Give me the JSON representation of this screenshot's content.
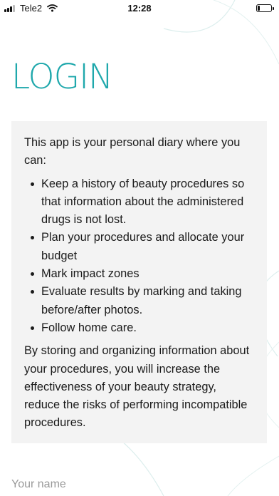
{
  "status_bar": {
    "carrier": "Tele2",
    "time": "12:28",
    "signal_bars_filled": 3,
    "signal_bars_total": 4,
    "battery_level": 0.2
  },
  "colors": {
    "accent": "#1fa8ac",
    "panel": "#f3f3f3",
    "arcs": "#dceeed"
  },
  "title": "LOGIN",
  "info": {
    "intro": "This app is your personal diary where you can:",
    "items": [
      "Keep a history of beauty procedures so that information about the administered drugs is not lost.",
      "Plan your procedures and allocate your budget",
      "Mark impact zones",
      "Evaluate results by marking and taking before/after photos.",
      "Follow home care."
    ],
    "outro": "By storing and organizing information about your procedures, you will increase the effectiveness of your beauty strategy, reduce the risks of performing incompatible procedures."
  },
  "name_field": {
    "placeholder": "Your name",
    "value": ""
  }
}
